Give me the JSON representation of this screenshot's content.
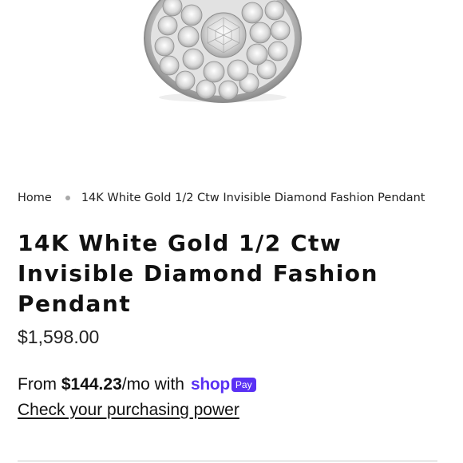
{
  "breadcrumb": {
    "home": "Home",
    "current": "14K White Gold 1/2 Ctw Invisible Diamond Fashion Pendant"
  },
  "product": {
    "title": "14K White Gold 1/2 Ctw Invisible Diamond Fashion Pendant",
    "price": "$1,598.00",
    "image_icon": "diamond-pendant-image"
  },
  "financing": {
    "prefix": "From",
    "amount": "$144.23",
    "suffix": "/mo with",
    "brand_shop": "shop",
    "brand_pay": "Pay",
    "brand_color": "#5a31f4",
    "link": "Check your purchasing power"
  }
}
